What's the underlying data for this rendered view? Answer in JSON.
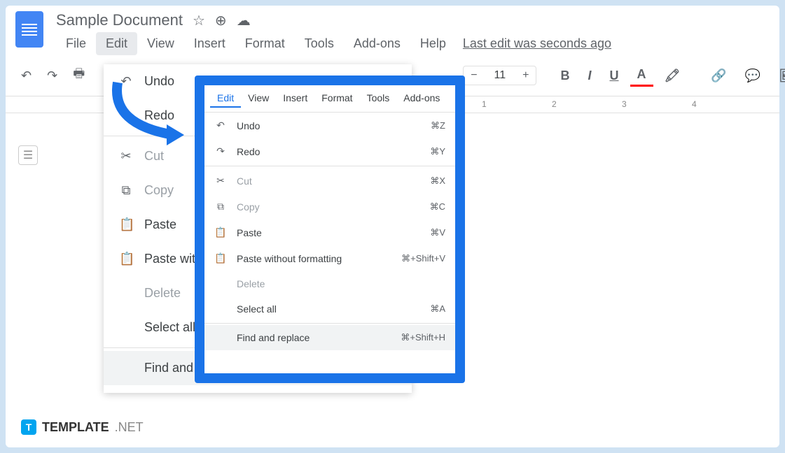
{
  "document": {
    "title": "Sample Document"
  },
  "menubar": {
    "items": [
      "File",
      "Edit",
      "View",
      "Insert",
      "Format",
      "Tools",
      "Add-ons",
      "Help"
    ],
    "last_edit": "Last edit was seconds ago"
  },
  "toolbar": {
    "font_size": "11"
  },
  "ruler": {
    "marks": [
      "1",
      "2",
      "3",
      "4"
    ]
  },
  "edit_menu_bg": {
    "items": [
      {
        "icon": "↶",
        "label": "Undo"
      },
      {
        "icon": "↷",
        "label": "Redo"
      },
      {
        "sep": true
      },
      {
        "icon": "✂",
        "label": "Cut",
        "disabled": true
      },
      {
        "icon": "⧉",
        "label": "Copy",
        "disabled": true
      },
      {
        "icon": "📋",
        "label": "Paste"
      },
      {
        "icon": "📋",
        "label": "Paste wit"
      },
      {
        "icon": "",
        "label": "Delete",
        "disabled": true
      },
      {
        "icon": "",
        "label": "Select all"
      },
      {
        "sep": true
      },
      {
        "icon": "",
        "label": "Find and",
        "highlight": true
      }
    ]
  },
  "callout_menubar": {
    "items": [
      "Edit",
      "View",
      "Insert",
      "Format",
      "Tools",
      "Add-ons"
    ]
  },
  "callout_menu": {
    "items": [
      {
        "icon": "↶",
        "label": "Undo",
        "shortcut": "⌘Z"
      },
      {
        "icon": "↷",
        "label": "Redo",
        "shortcut": "⌘Y"
      },
      {
        "sep": true
      },
      {
        "icon": "✂",
        "label": "Cut",
        "shortcut": "⌘X",
        "disabled": true
      },
      {
        "icon": "⧉",
        "label": "Copy",
        "shortcut": "⌘C",
        "disabled": true
      },
      {
        "icon": "📋",
        "label": "Paste",
        "shortcut": "⌘V"
      },
      {
        "icon": "📋",
        "label": "Paste without formatting",
        "shortcut": "⌘+Shift+V"
      },
      {
        "icon": "",
        "label": "Delete",
        "disabled": true
      },
      {
        "icon": "",
        "label": "Select all",
        "shortcut": "⌘A"
      },
      {
        "sep": true
      },
      {
        "icon": "",
        "label": "Find and replace",
        "shortcut": "⌘+Shift+H",
        "highlight": true
      }
    ]
  },
  "footer": {
    "brand": "TEMPLATE",
    "suffix": ".NET"
  }
}
